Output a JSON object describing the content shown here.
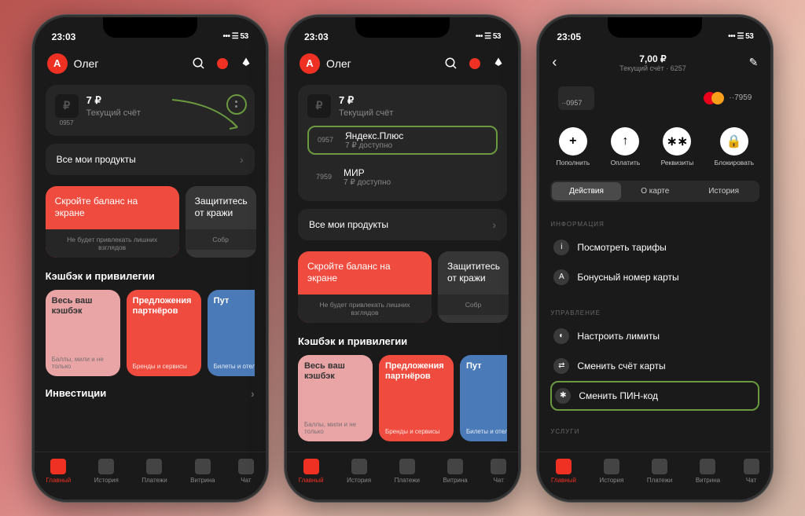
{
  "phone1": {
    "time": "23:03",
    "status_icons": "🐾",
    "signal": "􀙇 􀛨 53",
    "user": "Олег",
    "balance": "7 ₽",
    "account_label": "Текущий счёт",
    "account_num": "0957",
    "all_products": "Все мои продукты",
    "promo1_title": "Скройте баланс на экране",
    "promo1_foot": "Не будет привлекать лишних взглядов",
    "promo2_title": "Защититесь от кражи",
    "promo2_foot": "Собр",
    "section_cashback": "Кэшбэк и привилегии",
    "tile1_title": "Весь ваш кэшбэк",
    "tile1_sub": "Баллы, мили и не только",
    "tile2_title": "Предложения партнёров",
    "tile2_sub": "Бренды и сервисы",
    "tile3_title": "Пут",
    "tile3_sub": "Билеты и отели",
    "section_invest": "Инвестиции"
  },
  "phone2": {
    "time": "23:03",
    "user": "Олег",
    "balance": "7 ₽",
    "account_label": "Текущий счёт",
    "card1_num": "0957",
    "card1_title": "Яндекс.Плюс",
    "card1_sub": "7 ₽ доступно",
    "card2_num": "7959",
    "card2_title": "МИР",
    "card2_sub": "7 ₽ доступно",
    "all_products": "Все мои продукты",
    "promo1_title": "Скройте баланс на экране",
    "promo1_foot": "Не будет привлекать лишних взглядов",
    "promo2_title": "Защититесь от кражи",
    "promo2_foot": "Собр",
    "section_cashback": "Кэшбэк и привилегии",
    "tile1_title": "Весь ваш кэшбэк",
    "tile1_sub": "Баллы, мили и не только",
    "tile2_title": "Предложения партнёров",
    "tile2_sub": "Бренды и сервисы",
    "tile3_title": "Пут",
    "tile3_sub": "Билеты и отели"
  },
  "phone3": {
    "time": "23:05",
    "title": "7,00 ₽",
    "subtitle": "Текущий счёт · 6257",
    "card1": "··0957",
    "card2": "··7959",
    "act1": "Пополнить",
    "act2": "Оплатить",
    "act3": "Реквизиты",
    "act4": "Блокировать",
    "seg1": "Действия",
    "seg2": "О карте",
    "seg3": "История",
    "sec_info": "ИНФОРМАЦИЯ",
    "item_tariff": "Посмотреть тарифы",
    "item_bonus": "Бонусный номер карты",
    "sec_manage": "УПРАВЛЕНИЕ",
    "item_limits": "Настроить лимиты",
    "item_change_acc": "Сменить счёт карты",
    "item_pin": "Сменить ПИН-код",
    "sec_services": "УСЛУГИ"
  },
  "tabs": {
    "t1": "Главный",
    "t2": "История",
    "t3": "Платежи",
    "t4": "Витрина",
    "t5": "Чат"
  }
}
